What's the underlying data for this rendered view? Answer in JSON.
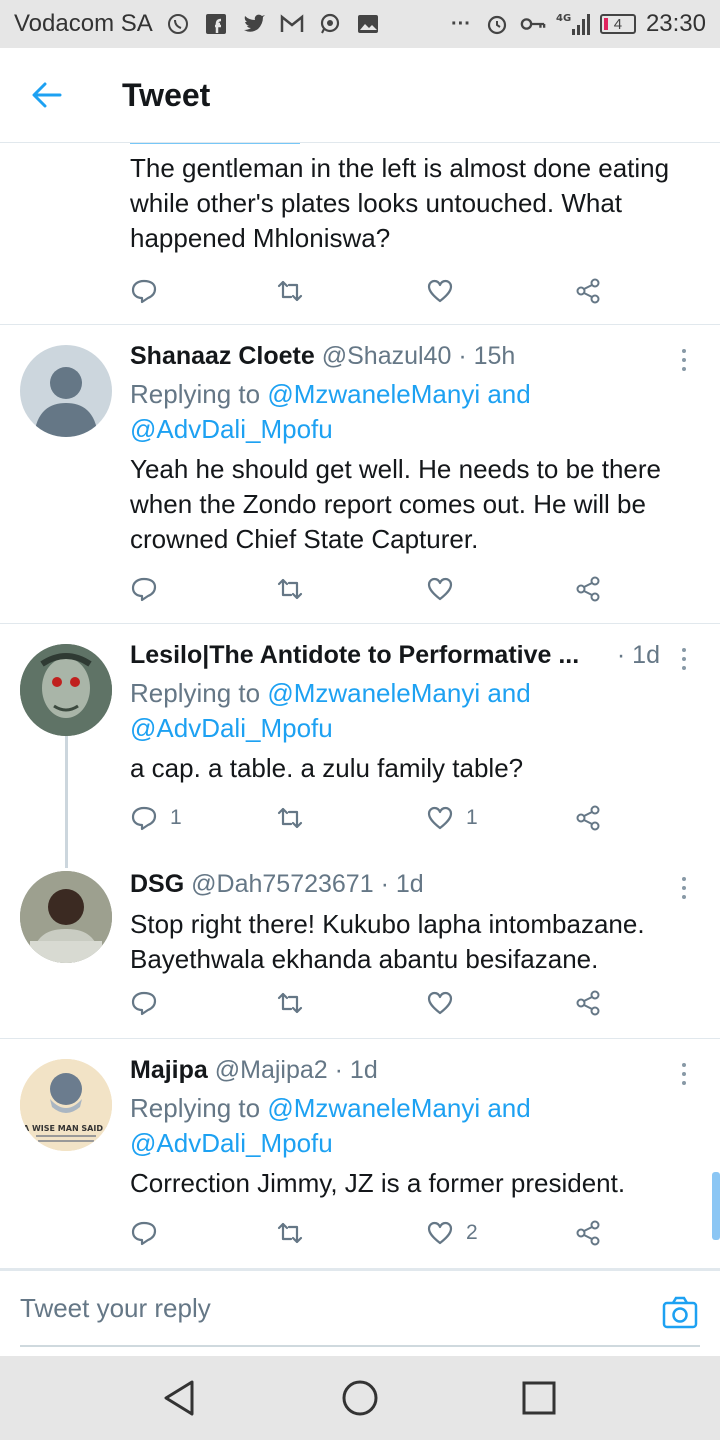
{
  "status_bar": {
    "carrier": "Vodacom SA",
    "network": "4G",
    "battery": "4",
    "time": "23:30",
    "icons": [
      "whatsapp-icon",
      "facebook-icon",
      "twitter-icon",
      "gmail-icon",
      "chat-icon",
      "gallery-icon",
      "more-dots-icon",
      "alarm-icon",
      "key-icon",
      "signal-icon"
    ]
  },
  "header": {
    "title": "Tweet",
    "back_icon": "arrow-left-icon"
  },
  "partial_tweet": {
    "text": "The gentleman in the left is almost done eating while other's plates looks untouched. What happened Mhloniswa?"
  },
  "tweets": [
    {
      "name": "Shanaaz Cloete",
      "handle": "@Shazul40",
      "time": "· 15h",
      "replying_prefix": "Replying to ",
      "replying_users": [
        "@MzwaneleManyi",
        "@AdvDali_Mpofu"
      ],
      "replying_joiner": " and",
      "text": "Yeah he should get well. He needs to be there when the Zondo report comes out. He will be crowned Chief State Capturer.",
      "reply_count": "",
      "like_count": ""
    },
    {
      "name": "Lesilo|The Antidote to Performative ...",
      "handle": "",
      "time": "· 1d",
      "replying_prefix": "Replying to ",
      "replying_users": [
        "@MzwaneleManyi",
        "@AdvDali_Mpofu"
      ],
      "replying_joiner": " and",
      "text": "a cap. a table. a zulu family table?",
      "reply_count": "1",
      "like_count": "1"
    },
    {
      "name": "DSG",
      "handle": "@Dah75723671",
      "time": "· 1d",
      "text": "Stop right there! Kukubo lapha intombazane. Bayethwala ekhanda abantu besifazane.",
      "reply_count": "",
      "like_count": ""
    },
    {
      "name": "Majipa",
      "handle": "@Majipa2",
      "time": "· 1d",
      "replying_prefix": "Replying to ",
      "replying_users": [
        "@MzwaneleManyi",
        "@AdvDali_Mpofu"
      ],
      "replying_joiner": " and",
      "text": "Correction Jimmy, JZ is a former president.",
      "reply_count": "",
      "like_count": "2",
      "avatar_text": "A WISE MAN SAID :"
    }
  ],
  "reply_bar": {
    "placeholder": "Tweet your reply",
    "camera_icon": "camera-icon"
  },
  "nav_bar": {
    "icons": [
      "back-triangle-icon",
      "home-circle-icon",
      "recents-square-icon"
    ]
  },
  "colors": {
    "accent": "#1da1f2",
    "text": "#14171a",
    "muted": "#657786"
  }
}
